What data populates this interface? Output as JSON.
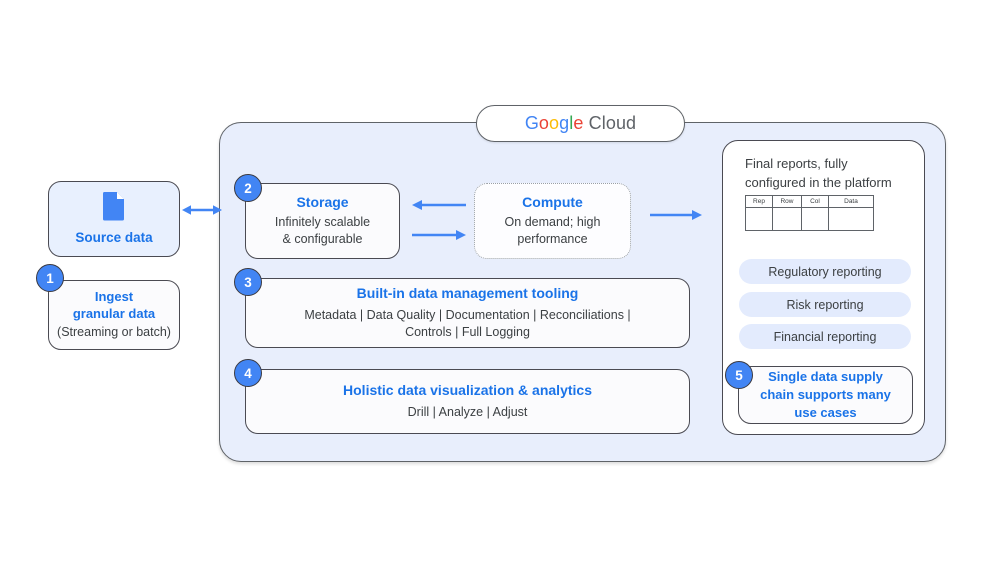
{
  "cloud": {
    "logo_google": [
      "G",
      "o",
      "o",
      "g",
      "l",
      "e"
    ],
    "logo_cloud": "Cloud"
  },
  "left_column": {
    "source": {
      "label": "Source data",
      "icon": "document-icon"
    },
    "ingest": {
      "badge": "1",
      "title_line1": "Ingest",
      "title_line2": "granular data",
      "subtitle": "(Streaming or batch)"
    }
  },
  "platform": {
    "storage": {
      "badge": "2",
      "title": "Storage",
      "line1": "Infinitely scalable",
      "line2": "& configurable"
    },
    "compute": {
      "title": "Compute",
      "line1": "On demand; high",
      "line2": "performance"
    },
    "tooling": {
      "badge": "3",
      "title": "Built-in data management tooling",
      "line1": "Metadata | Data Quality | Documentation | Reconciliations |",
      "line2": "Controls | Full Logging"
    },
    "visualization": {
      "badge": "4",
      "title": "Holistic data visualization & analytics",
      "line1": "Drill | Analyze | Adjust"
    }
  },
  "reports": {
    "heading_line1": "Final reports, fully",
    "heading_line2": "configured in the platform",
    "table": {
      "headers": [
        "Rep",
        "Row",
        "Col",
        "Data"
      ],
      "rows": [
        [
          "",
          "",
          "",
          ""
        ]
      ]
    },
    "pills": [
      "Regulatory reporting",
      "Risk reporting",
      "Financial reporting"
    ],
    "usecase": {
      "badge": "5",
      "line1": "Single data supply",
      "line2": "chain supports many",
      "line3": "use cases"
    }
  },
  "colors": {
    "accent_blue": "#1a73e8",
    "google_blue": "#4285f4",
    "google_red": "#ea4335",
    "google_yellow": "#fbbc05",
    "google_green": "#34a853",
    "panel_bg": "#e8eefc",
    "pill_bg": "#e3ebfd",
    "source_bg": "#e8f0fe"
  }
}
